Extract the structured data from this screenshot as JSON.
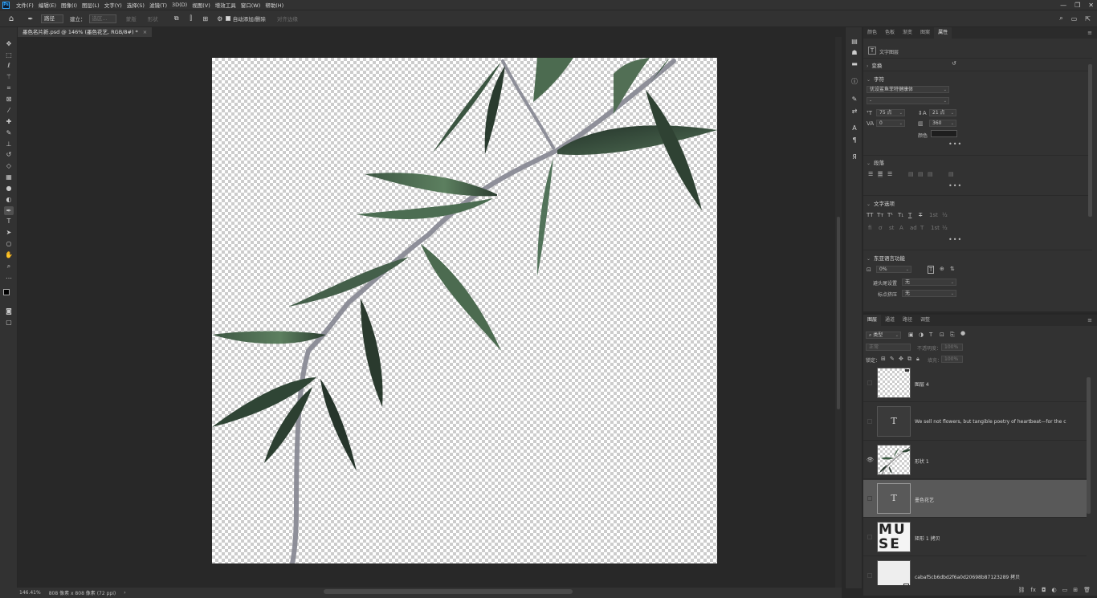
{
  "app": {
    "logo": "Ps"
  },
  "menubar": {
    "items": [
      "文件(F)",
      "编辑(E)",
      "图像(I)",
      "图层(L)",
      "文字(Y)",
      "选择(S)",
      "滤镜(T)",
      "3D(D)",
      "视图(V)",
      "增效工具",
      "窗口(W)",
      "帮助(H)"
    ]
  },
  "window_controls": {
    "minimize": "—",
    "restore": "❐",
    "close": "✕"
  },
  "options": {
    "tool_mode": "路径",
    "make": "建立：",
    "selection": "选区...",
    "mask": "蒙版",
    "shape": "形状",
    "auto_add_delete": "自动添加/删除",
    "align_edges": "对齐边缘"
  },
  "document": {
    "tab_title": "墨色名片新.psd @ 146% (墨色花艺, RGB/8#) *",
    "close": "×"
  },
  "status": {
    "zoom": "146.41%",
    "info": "808 像素 x 808 像素 (72 ppi)",
    "arrow": "›"
  },
  "properties": {
    "tabs": [
      "颜色",
      "色板",
      "渐变",
      "图案",
      "属性"
    ],
    "active_tab": "属性",
    "layer_kind": "文字图层",
    "transform": "变换",
    "character": {
      "header": "字符",
      "font": "优设鲨鱼菲特健康体",
      "style": "-",
      "size": "75 点",
      "leading": "21 点",
      "kerning": "0",
      "tracking": "360",
      "color_label": "颜色",
      "color": "#1e1e1e"
    },
    "paragraph": {
      "header": "段落"
    },
    "type_options": {
      "header": "文字选项"
    },
    "east_asian": {
      "header": "东亚语言功能",
      "tsume": "0%",
      "kinsoku_label": "避头尾设置",
      "kinsoku_value": "无",
      "mojikumi_label": "标点挤压",
      "mojikumi_value": "无"
    },
    "more": "•••"
  },
  "layers": {
    "tabs": [
      "图层",
      "通道",
      "路径",
      "调整"
    ],
    "active_tab": "图层",
    "filter_kind": "类型",
    "blend_mode": "正常",
    "opacity_label": "不透明度：",
    "opacity": "100%",
    "lock_label": "锁定：",
    "fill_label": "填充：",
    "fill": "100%",
    "items": [
      {
        "name": "图层 4",
        "visible": false,
        "thumb": "checker",
        "selected": false
      },
      {
        "name": "We sell not flowers, but tangible poetry of heartbeat—for the c",
        "visible": false,
        "thumb": "text",
        "selected": false
      },
      {
        "name": "形状 1",
        "visible": true,
        "thumb": "bamboo",
        "selected": false
      },
      {
        "name": "墨色花艺",
        "visible": false,
        "thumb": "text",
        "selected": true
      },
      {
        "name": "矩形 1 拷贝",
        "visible": false,
        "thumb": "muse",
        "selected": false
      },
      {
        "name": "cabaf5cb6dbd2f6a0d20698b87123289 拷贝",
        "visible": false,
        "thumb": "plain",
        "selected": false
      }
    ],
    "text_glyph": "T",
    "muse_text": "MUSE"
  },
  "icons": {
    "move": "move-icon",
    "marquee": "marquee-icon",
    "lasso": "lasso-icon",
    "magic_wand": "magic-wand-icon",
    "crop": "crop-icon",
    "eyedropper": "eyedropper-icon",
    "pen": "pen-icon",
    "type": "type-icon"
  }
}
